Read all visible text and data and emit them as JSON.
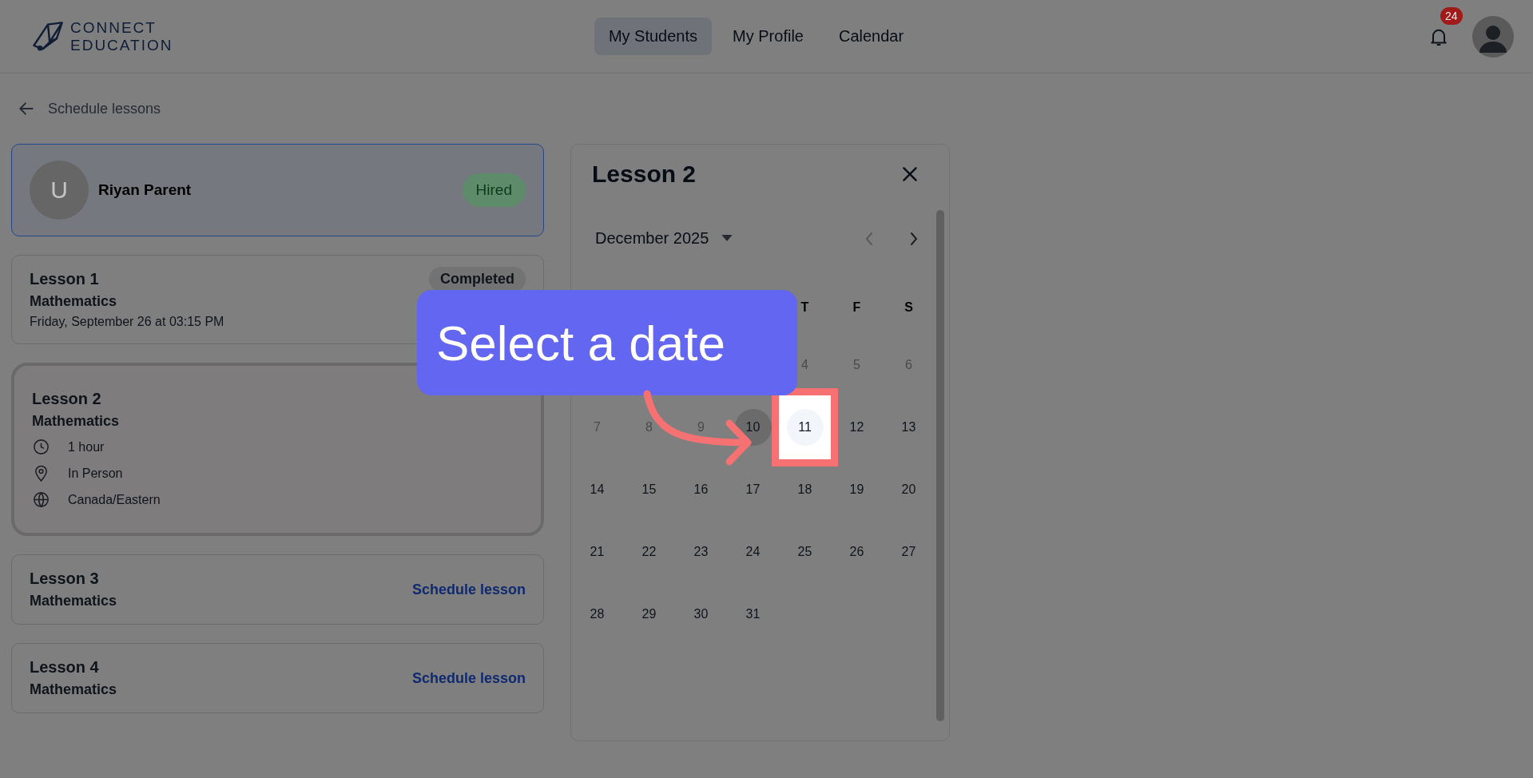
{
  "header": {
    "logo": [
      "CONNECT",
      "EDUCATION"
    ],
    "nav": [
      {
        "label": "My Students",
        "selected": true
      },
      {
        "label": "My Profile",
        "selected": false
      },
      {
        "label": "Calendar",
        "selected": false
      }
    ],
    "notifications": "24"
  },
  "back_link": "Schedule lessons",
  "student": {
    "initial": "U",
    "name": "Riyan Parent",
    "status": "Hired"
  },
  "lessons": [
    {
      "title": "Lesson 1",
      "subject": "Mathematics",
      "when": "Friday, September 26 at 03:15 PM",
      "badge": "Completed",
      "selected": false
    },
    {
      "title": "Lesson 2",
      "subject": "Mathematics",
      "selected": true,
      "details": [
        {
          "kind": "clock",
          "text": "1 hour"
        },
        {
          "kind": "pin",
          "text": "In Person"
        },
        {
          "kind": "globe",
          "text": "Canada/Eastern"
        }
      ]
    },
    {
      "title": "Lesson 3",
      "subject": "Mathematics",
      "action": "Schedule lesson",
      "selected": false
    },
    {
      "title": "Lesson 4",
      "subject": "Mathematics",
      "action": "Schedule lesson",
      "selected": false
    }
  ],
  "panel": {
    "title": "Lesson 2",
    "month": "December 2025",
    "prev_disabled": true,
    "weekdays": [
      "T",
      "F",
      "S"
    ],
    "weeks": [
      [
        {
          "label": "4",
          "disabled": true
        },
        {
          "label": "5",
          "disabled": true
        },
        {
          "label": "6",
          "disabled": true
        }
      ],
      [
        {
          "label": "7",
          "disabled": true
        },
        {
          "label": "8",
          "disabled": true
        },
        {
          "label": "9",
          "disabled": true
        },
        {
          "label": "10",
          "today": true
        },
        {
          "label": "11",
          "selected": true
        },
        {
          "label": "12"
        },
        {
          "label": "13"
        }
      ],
      [
        {
          "label": "14"
        },
        {
          "label": "15"
        },
        {
          "label": "16"
        },
        {
          "label": "17"
        },
        {
          "label": "18"
        },
        {
          "label": "19"
        },
        {
          "label": "20"
        }
      ],
      [
        {
          "label": "21"
        },
        {
          "label": "22"
        },
        {
          "label": "23"
        },
        {
          "label": "24"
        },
        {
          "label": "25"
        },
        {
          "label": "26"
        },
        {
          "label": "27"
        }
      ],
      [
        {
          "label": "28"
        },
        {
          "label": "29"
        },
        {
          "label": "30"
        },
        {
          "label": "31"
        }
      ]
    ]
  },
  "tutorial": {
    "text": "Select a date"
  }
}
